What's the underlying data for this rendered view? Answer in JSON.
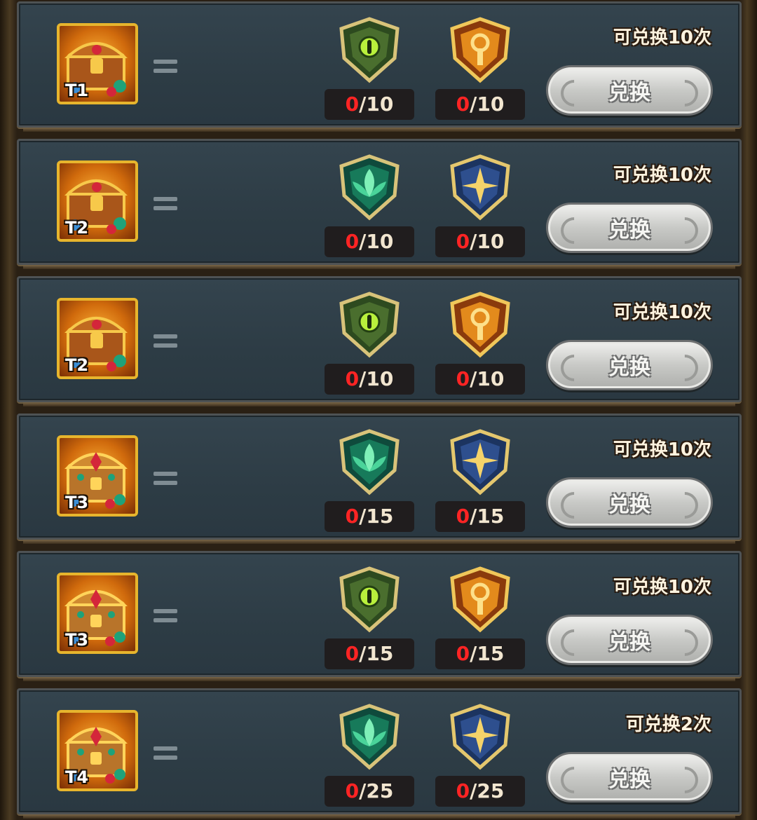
{
  "rows": [
    {
      "tier": "T1",
      "chest": "chest-basic",
      "remain": "可兑换10次",
      "button": "兑换",
      "cost": [
        {
          "icon": "green-eye-emblem-icon",
          "have": "0",
          "need": "/10"
        },
        {
          "icon": "orange-sigil-emblem-icon",
          "have": "0",
          "need": "/10"
        }
      ]
    },
    {
      "tier": "T2",
      "chest": "chest-basic",
      "remain": "可兑换10次",
      "button": "兑换",
      "cost": [
        {
          "icon": "teal-leaf-emblem-icon",
          "have": "0",
          "need": "/10"
        },
        {
          "icon": "blue-star-emblem-icon",
          "have": "0",
          "need": "/10"
        }
      ]
    },
    {
      "tier": "T2",
      "chest": "chest-basic",
      "remain": "可兑换10次",
      "button": "兑换",
      "cost": [
        {
          "icon": "green-eye-emblem-icon",
          "have": "0",
          "need": "/10"
        },
        {
          "icon": "orange-sigil-emblem-icon",
          "have": "0",
          "need": "/10"
        }
      ]
    },
    {
      "tier": "T3",
      "chest": "chest-ornate",
      "remain": "可兑换10次",
      "button": "兑换",
      "cost": [
        {
          "icon": "teal-leaf-emblem-icon",
          "have": "0",
          "need": "/15"
        },
        {
          "icon": "blue-star-emblem-icon",
          "have": "0",
          "need": "/15"
        }
      ]
    },
    {
      "tier": "T3",
      "chest": "chest-ornate",
      "remain": "可兑换10次",
      "button": "兑换",
      "cost": [
        {
          "icon": "green-eye-emblem-icon",
          "have": "0",
          "need": "/15"
        },
        {
          "icon": "orange-sigil-emblem-icon",
          "have": "0",
          "need": "/15"
        }
      ]
    },
    {
      "tier": "T4",
      "chest": "chest-ornate",
      "remain": "可兑换2次",
      "button": "兑换",
      "cost": [
        {
          "icon": "teal-leaf-emblem-icon",
          "have": "0",
          "need": "/25"
        },
        {
          "icon": "blue-star-emblem-icon",
          "have": "0",
          "need": "/25"
        }
      ]
    }
  ],
  "colors": {
    "counter_have": "#ff2424",
    "chest_border": "#e7b52d",
    "panel": "#2d3c45"
  }
}
